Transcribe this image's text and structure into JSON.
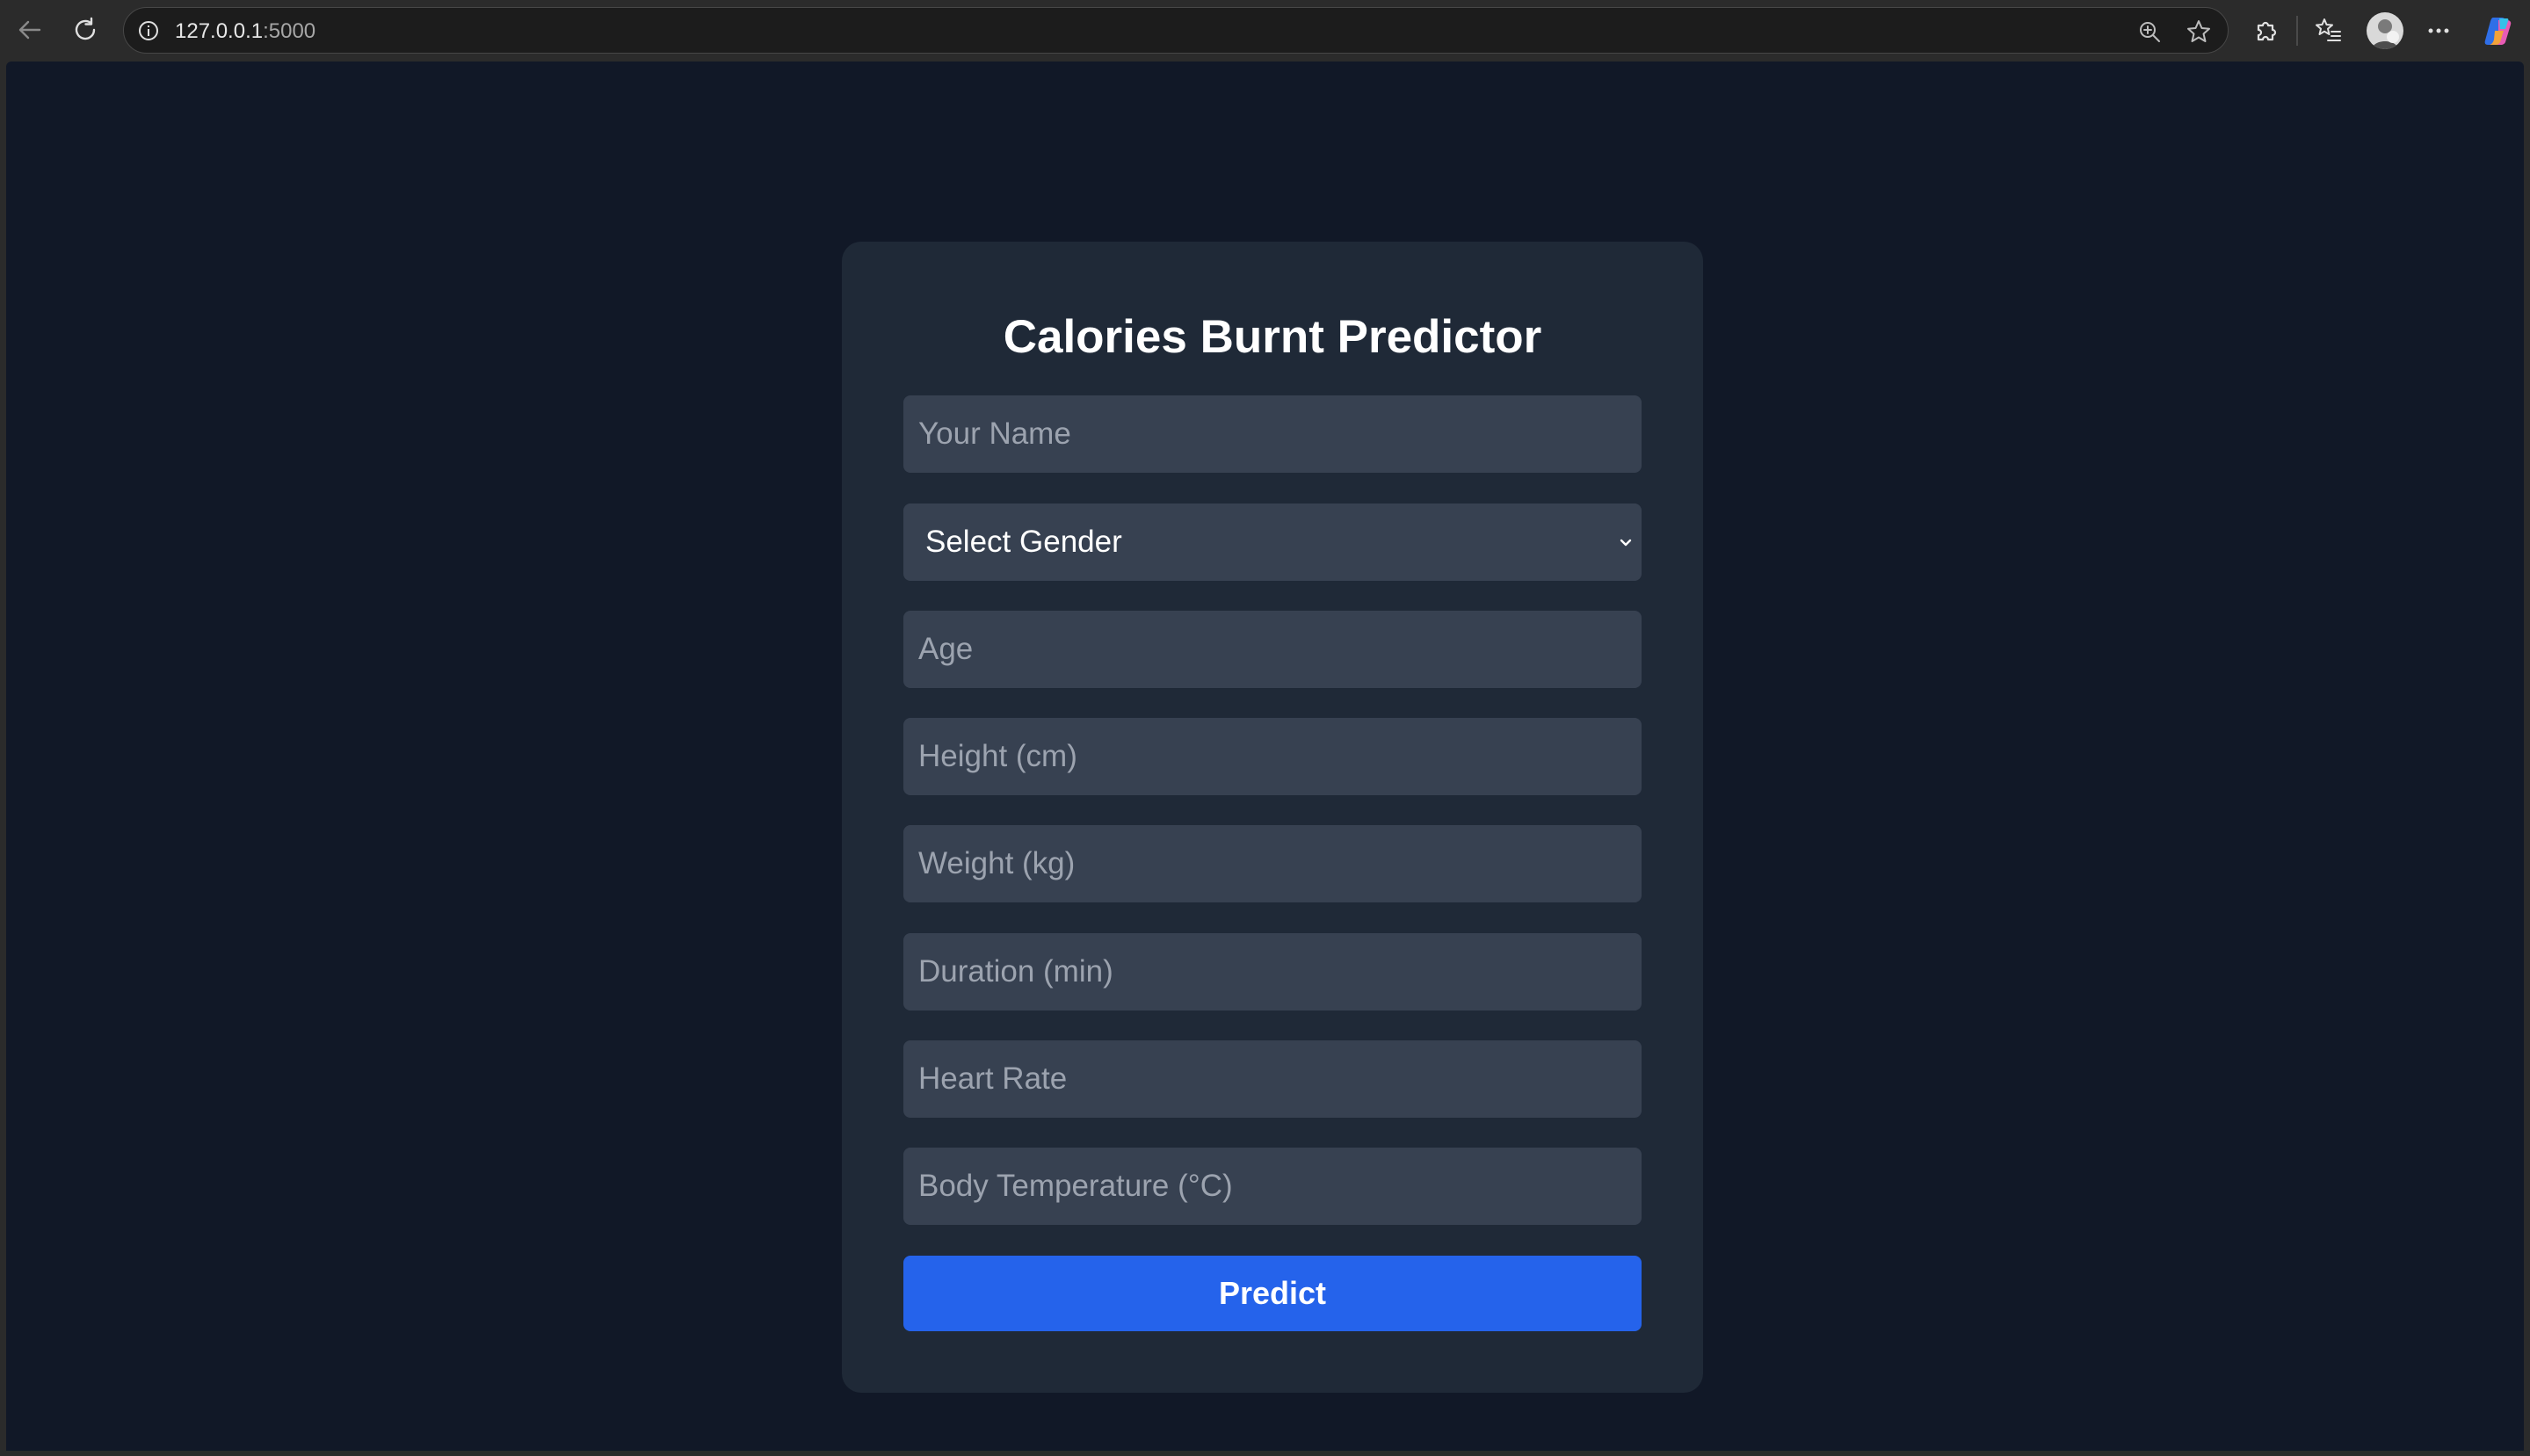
{
  "browser": {
    "url_host": "127.0.0.1",
    "url_port": ":5000"
  },
  "form": {
    "title": "Calories Burnt Predictor",
    "fields": [
      {
        "placeholder": "Your Name",
        "value": ""
      },
      {
        "placeholder": "Age",
        "value": ""
      },
      {
        "placeholder": "Height (cm)",
        "value": ""
      },
      {
        "placeholder": "Weight (kg)",
        "value": ""
      },
      {
        "placeholder": "Duration (min)",
        "value": ""
      },
      {
        "placeholder": "Heart Rate",
        "value": ""
      },
      {
        "placeholder": "Body Temperature (°C)",
        "value": ""
      }
    ],
    "gender_select": {
      "selected": "Select Gender"
    },
    "submit_label": "Predict"
  },
  "colors": {
    "page_background": "#111827",
    "card_background": "#1f2937",
    "input_background": "#374151",
    "placeholder": "#9ca3af",
    "accent": "#2563eb"
  },
  "icons": {
    "back": "back-arrow-icon",
    "reload": "reload-icon",
    "site_info": "info-icon",
    "zoom": "zoom-icon",
    "favorite": "star-icon",
    "extensions": "puzzle-icon",
    "favorites": "favorites-list-icon",
    "menu": "more-icon",
    "copilot": "copilot-icon"
  }
}
